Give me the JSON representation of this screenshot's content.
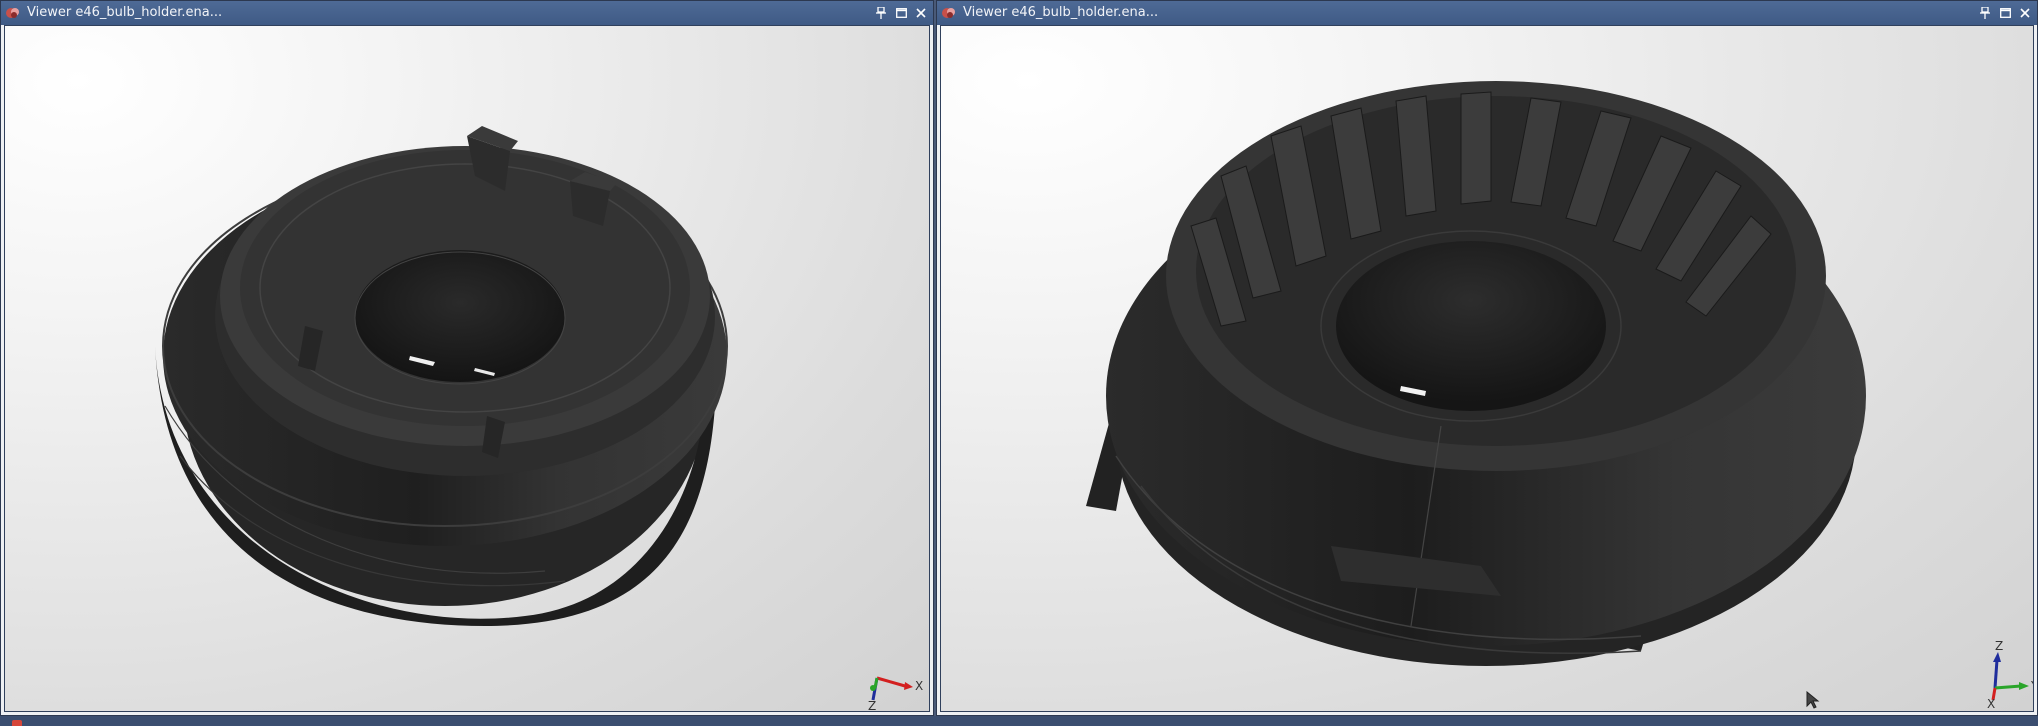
{
  "windows": [
    {
      "title": "Viewer e46_bulb_holder.ena...",
      "triad_labels": [
        "X",
        "Z"
      ]
    },
    {
      "title": "Viewer e46_bulb_holder.ena...",
      "triad_labels": [
        "Z",
        "Y",
        "X"
      ]
    }
  ],
  "controls": {
    "pin_icon": "pin-icon",
    "maximize_icon": "maximize-icon",
    "close_icon": "close-icon"
  },
  "colors": {
    "titlebar": "#4e6a96",
    "model": "#2e2e2e",
    "axis_x": "#d32020",
    "axis_y": "#2aa52a",
    "axis_z": "#1f2d9c"
  }
}
